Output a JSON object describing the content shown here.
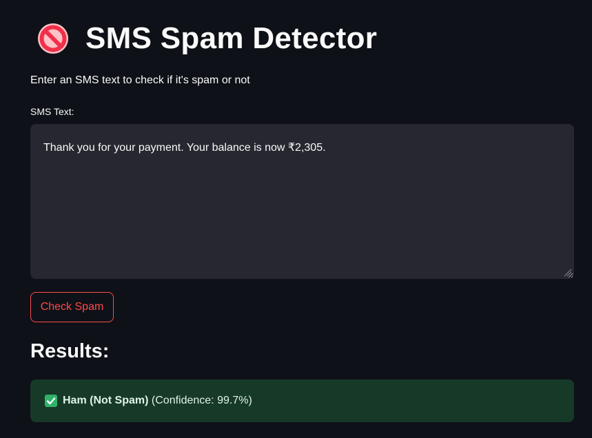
{
  "app": {
    "title": "SMS Spam Detector",
    "title_icon": "no-entry-icon",
    "subtitle": "Enter an SMS text to check if it's spam or not"
  },
  "form": {
    "textarea_label": "SMS Text:",
    "textarea_value": "Thank you for your payment. Your balance is now ₹2,305.",
    "button_label": "Check Spam"
  },
  "results": {
    "heading": "Results:",
    "status_icon": "check-mark-icon",
    "prediction": "Ham (Not Spam)",
    "confidence_text": "(Confidence: 99.7%)"
  },
  "colors": {
    "background": "#0e1117",
    "input_background": "#262730",
    "accent": "#ff4b4b",
    "success_background": "#173928",
    "success_icon": "#2fb36a"
  }
}
